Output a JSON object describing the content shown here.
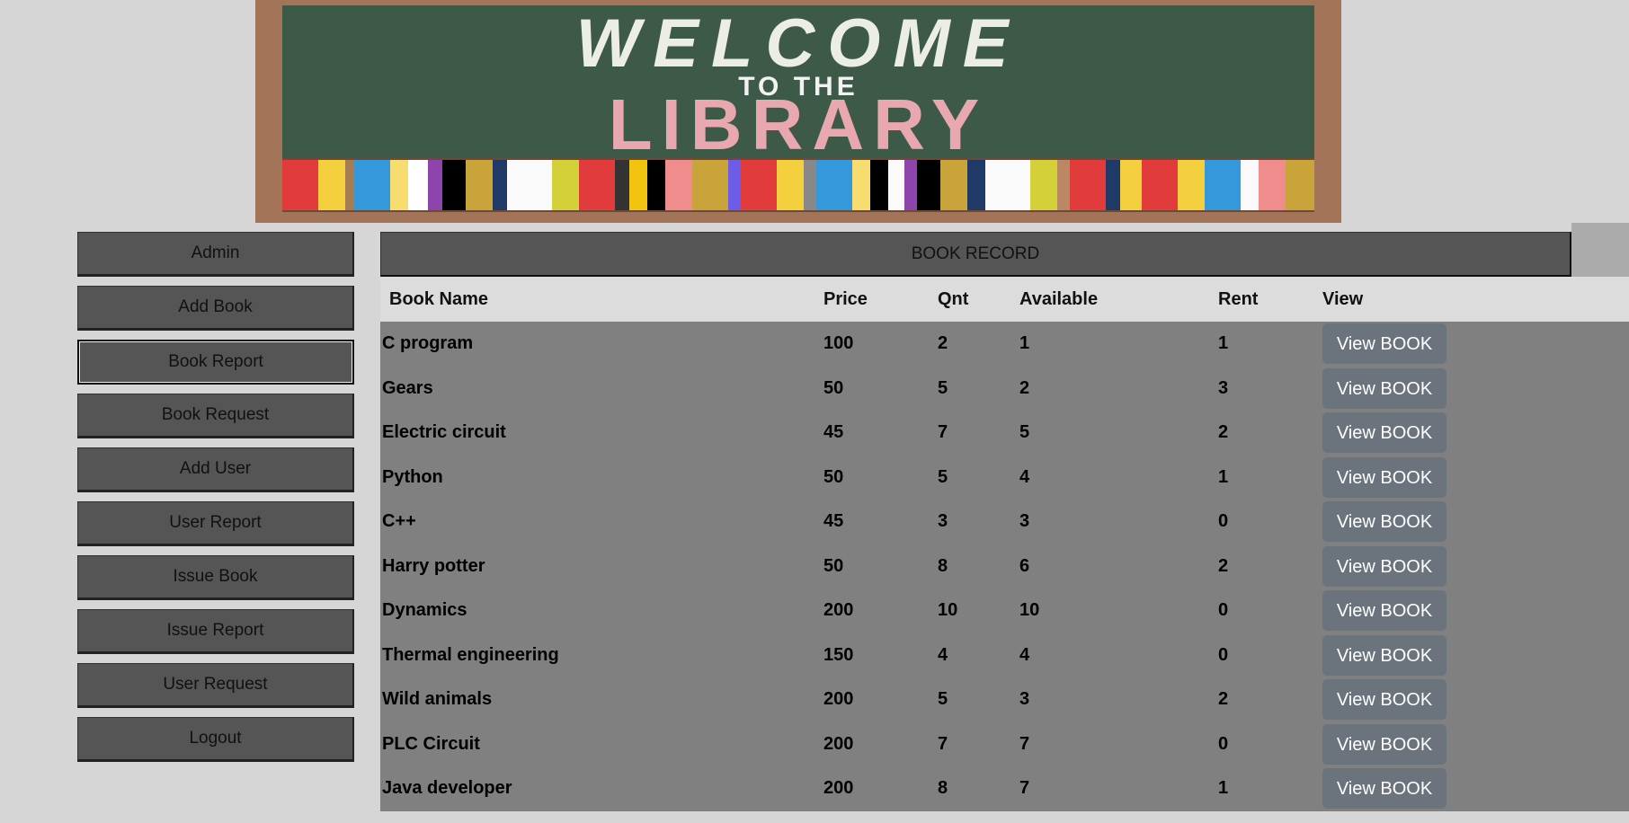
{
  "banner": {
    "line1": "WELCOME",
    "line2": "TO THE",
    "line3": "LIBRARY"
  },
  "sidebar": {
    "items": [
      {
        "label": "Admin",
        "active": false
      },
      {
        "label": "Add Book",
        "active": false
      },
      {
        "label": "Book Report",
        "active": true
      },
      {
        "label": "Book Request",
        "active": false
      },
      {
        "label": "Add User",
        "active": false
      },
      {
        "label": "User Report",
        "active": false
      },
      {
        "label": "Issue Book",
        "active": false
      },
      {
        "label": "Issue Report",
        "active": false
      },
      {
        "label": "User Request",
        "active": false
      },
      {
        "label": "Logout",
        "active": false
      }
    ]
  },
  "main": {
    "title": "BOOK RECORD",
    "columns": [
      "Book Name",
      "Price",
      "Qnt",
      "Available",
      "Rent",
      "View"
    ],
    "view_label": "View BOOK",
    "rows": [
      {
        "name": "C program",
        "price": "100",
        "qnt": "2",
        "available": "1",
        "rent": "1"
      },
      {
        "name": "Gears",
        "price": "50",
        "qnt": "5",
        "available": "2",
        "rent": "3"
      },
      {
        "name": "Electric circuit",
        "price": "45",
        "qnt": "7",
        "available": "5",
        "rent": "2"
      },
      {
        "name": "Python",
        "price": "50",
        "qnt": "5",
        "available": "4",
        "rent": "1"
      },
      {
        "name": "C++",
        "price": "45",
        "qnt": "3",
        "available": "3",
        "rent": "0"
      },
      {
        "name": "Harry potter",
        "price": "50",
        "qnt": "8",
        "available": "6",
        "rent": "2"
      },
      {
        "name": "Dynamics",
        "price": "200",
        "qnt": "10",
        "available": "10",
        "rent": "0"
      },
      {
        "name": "Thermal engineering",
        "price": "150",
        "qnt": "4",
        "available": "4",
        "rent": "0"
      },
      {
        "name": "Wild animals",
        "price": "200",
        "qnt": "5",
        "available": "3",
        "rent": "2"
      },
      {
        "name": "PLC Circuit",
        "price": "200",
        "qnt": "7",
        "available": "7",
        "rent": "0"
      },
      {
        "name": "Java developer",
        "price": "200",
        "qnt": "8",
        "available": "7",
        "rent": "1"
      }
    ]
  },
  "colors": {
    "page_bg": "#d6d6d6",
    "button_bg": "#555555",
    "table_bg": "#808080",
    "view_button_bg": "#6b747d",
    "board_green": "#3c5a47",
    "frame_brown": "#a47458"
  }
}
